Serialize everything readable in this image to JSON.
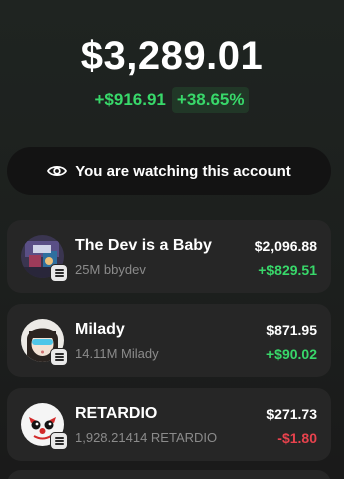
{
  "portfolio": {
    "balance": "$3,289.01",
    "pnl_abs": "+$916.91",
    "pnl_pct": "+38.65%"
  },
  "watch_banner": {
    "icon": "eye-icon",
    "text": "You are watching this account"
  },
  "tokens": [
    {
      "name": "The Dev is a Baby",
      "holding": "25M bbydev",
      "value": "$2,096.88",
      "change": "+$829.51",
      "direction": "up"
    },
    {
      "name": "Milady",
      "holding": "14.11M Milady",
      "value": "$871.95",
      "change": "+$90.02",
      "direction": "up"
    },
    {
      "name": "RETARDIO",
      "holding": "1,928.21414 RETARDIO",
      "value": "$271.73",
      "change": "-$1.80",
      "direction": "down"
    }
  ],
  "colors": {
    "positive": "#38d86a",
    "negative": "#e8424d",
    "card_bg": "#262626"
  }
}
